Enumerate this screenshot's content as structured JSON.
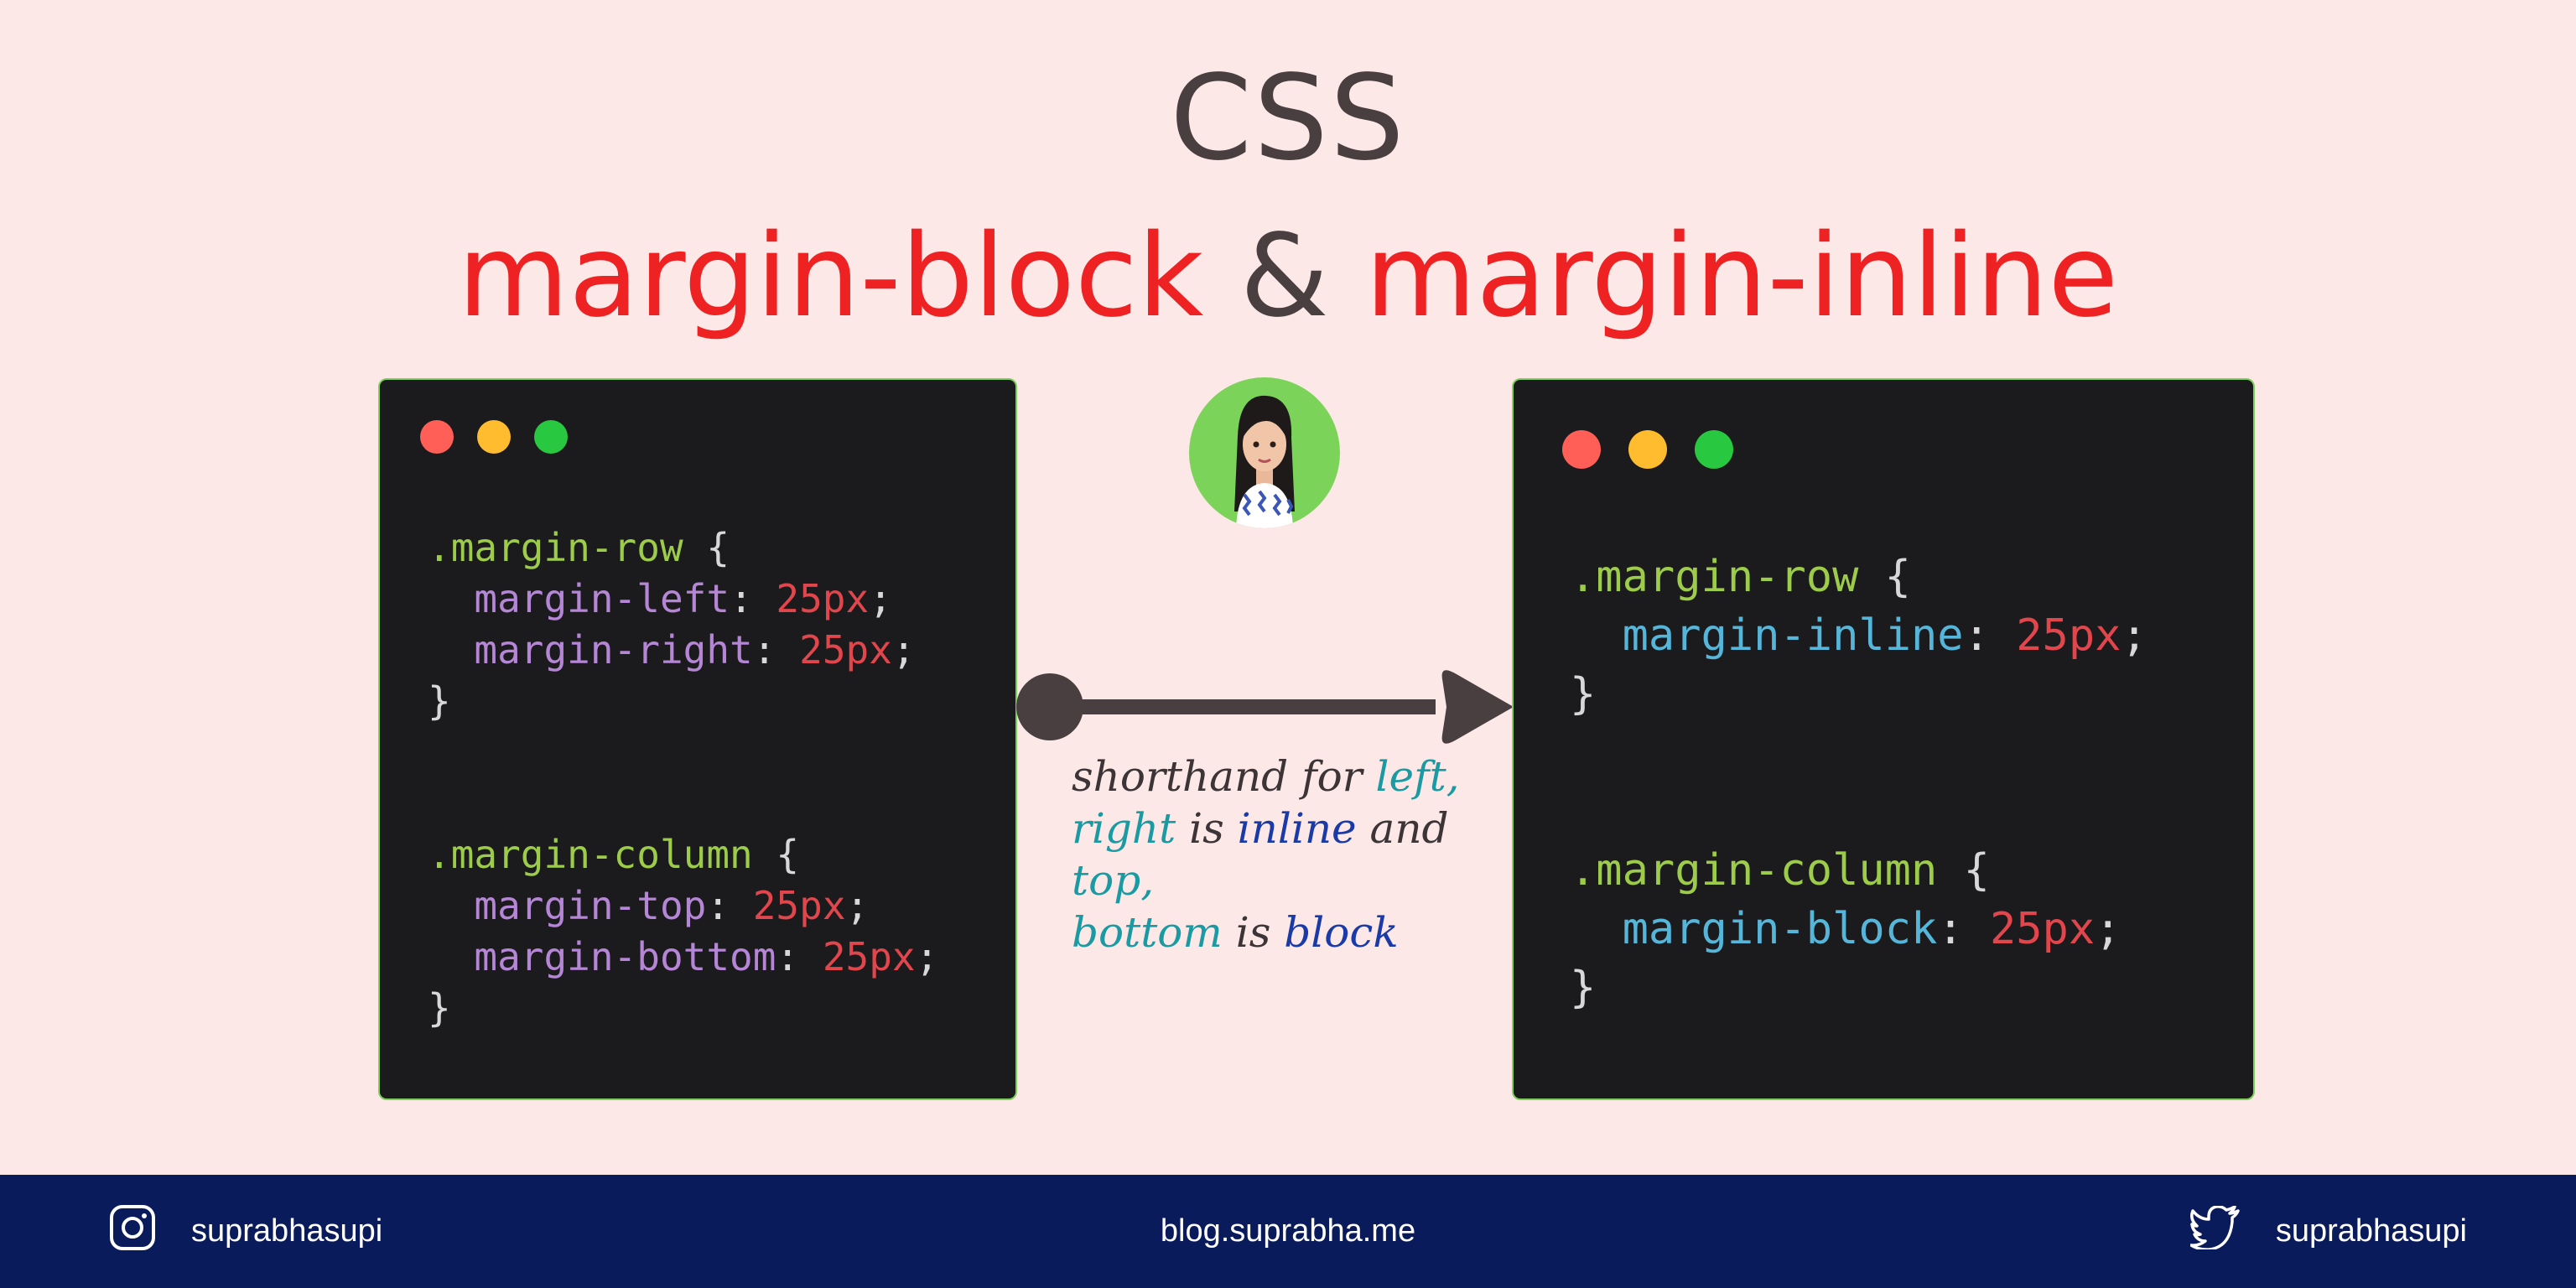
{
  "title": {
    "line1": "CSS",
    "part1": "margin-block",
    "amp": "&",
    "part2": "margin-inline"
  },
  "left_code": {
    "row_selector": ".margin-row",
    "open_brace": " {",
    "prop_left": "margin-left",
    "prop_right": "margin-right",
    "prop_top": "margin-top",
    "prop_bottom": "margin-bottom",
    "value": "25px",
    "col_selector": ".margin-column",
    "close_brace": "}"
  },
  "right_code": {
    "row_selector": ".margin-row",
    "open_brace": " {",
    "prop_inline": "margin-inline",
    "prop_block": "margin-block",
    "value": "25px",
    "col_selector": ".margin-column",
    "close_brace": "}"
  },
  "note": {
    "w1": "shorthand for ",
    "w2": "left,",
    "w3": "right",
    "w4": " is ",
    "w5": "inline",
    "w6": " and ",
    "w7": "top,",
    "w8": "bottom",
    "w9": " is ",
    "w10": "block"
  },
  "footer": {
    "instagram_handle": "suprabhasupi",
    "blog": "blog.suprabha.me",
    "twitter_handle": "suprabhasupi"
  },
  "colors": {
    "background": "#fde8e8",
    "title_red": "#ee2222",
    "footer_bg": "#0a1b5c",
    "avatar_bg": "#7bd35a"
  },
  "icons": [
    "instagram-icon",
    "twitter-icon",
    "avatar-illustration"
  ]
}
